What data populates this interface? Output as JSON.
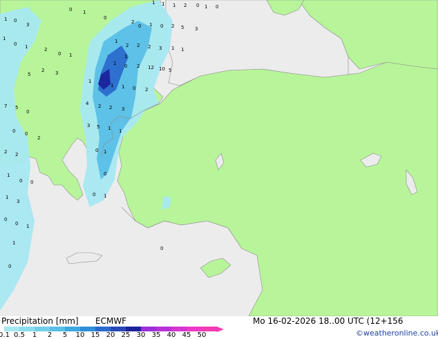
{
  "footer": {
    "title": "Precipitation [mm]",
    "model": "ECMWF",
    "datetime": "Mo 16-02-2026 18..00 UTC (12+156",
    "copyright": "©weatheronline.co.uk"
  },
  "legend": {
    "ticks": [
      "0.1",
      "0.5",
      "1",
      "2",
      "5",
      "10",
      "15",
      "20",
      "25",
      "30",
      "35",
      "40",
      "45",
      "50"
    ],
    "colors": [
      "#a6e8f2",
      "#8edcee",
      "#74cfea",
      "#5abfe6",
      "#3ea8e0",
      "#2f8fd8",
      "#2a6bcc",
      "#2948b8",
      "#1b229a",
      "#9b2fd8",
      "#b832d8",
      "#d736d0",
      "#ee3ac8",
      "#f13cb3"
    ]
  },
  "map": {
    "land_color": "#b8f59a",
    "non_model_color": "#ececec",
    "sea_color": "#ececec",
    "values": [
      "0",
      "1",
      "0",
      "3",
      "1",
      "0",
      "1",
      "2",
      "0",
      "1",
      "0",
      "2",
      "1",
      "1",
      "1",
      "2",
      "0",
      "1",
      "0",
      "0",
      "1",
      "0",
      "2",
      "5",
      "3",
      "1",
      "2",
      "2",
      "2",
      "3",
      "1",
      "1",
      "1",
      "1",
      "0",
      "2",
      "12",
      "10",
      "5",
      "1",
      "1",
      "1",
      "0",
      "2",
      "4",
      "2",
      "2",
      "3",
      "3",
      "5",
      "1",
      "1",
      "0",
      "1",
      "0",
      "0",
      "1",
      "5",
      "2",
      "3",
      "7",
      "5",
      "0",
      "0",
      "0",
      "2",
      "2",
      "2",
      "1",
      "0",
      "0",
      "1",
      "3",
      "0",
      "0",
      "1",
      "1",
      "0",
      "0",
      "1"
    ]
  }
}
